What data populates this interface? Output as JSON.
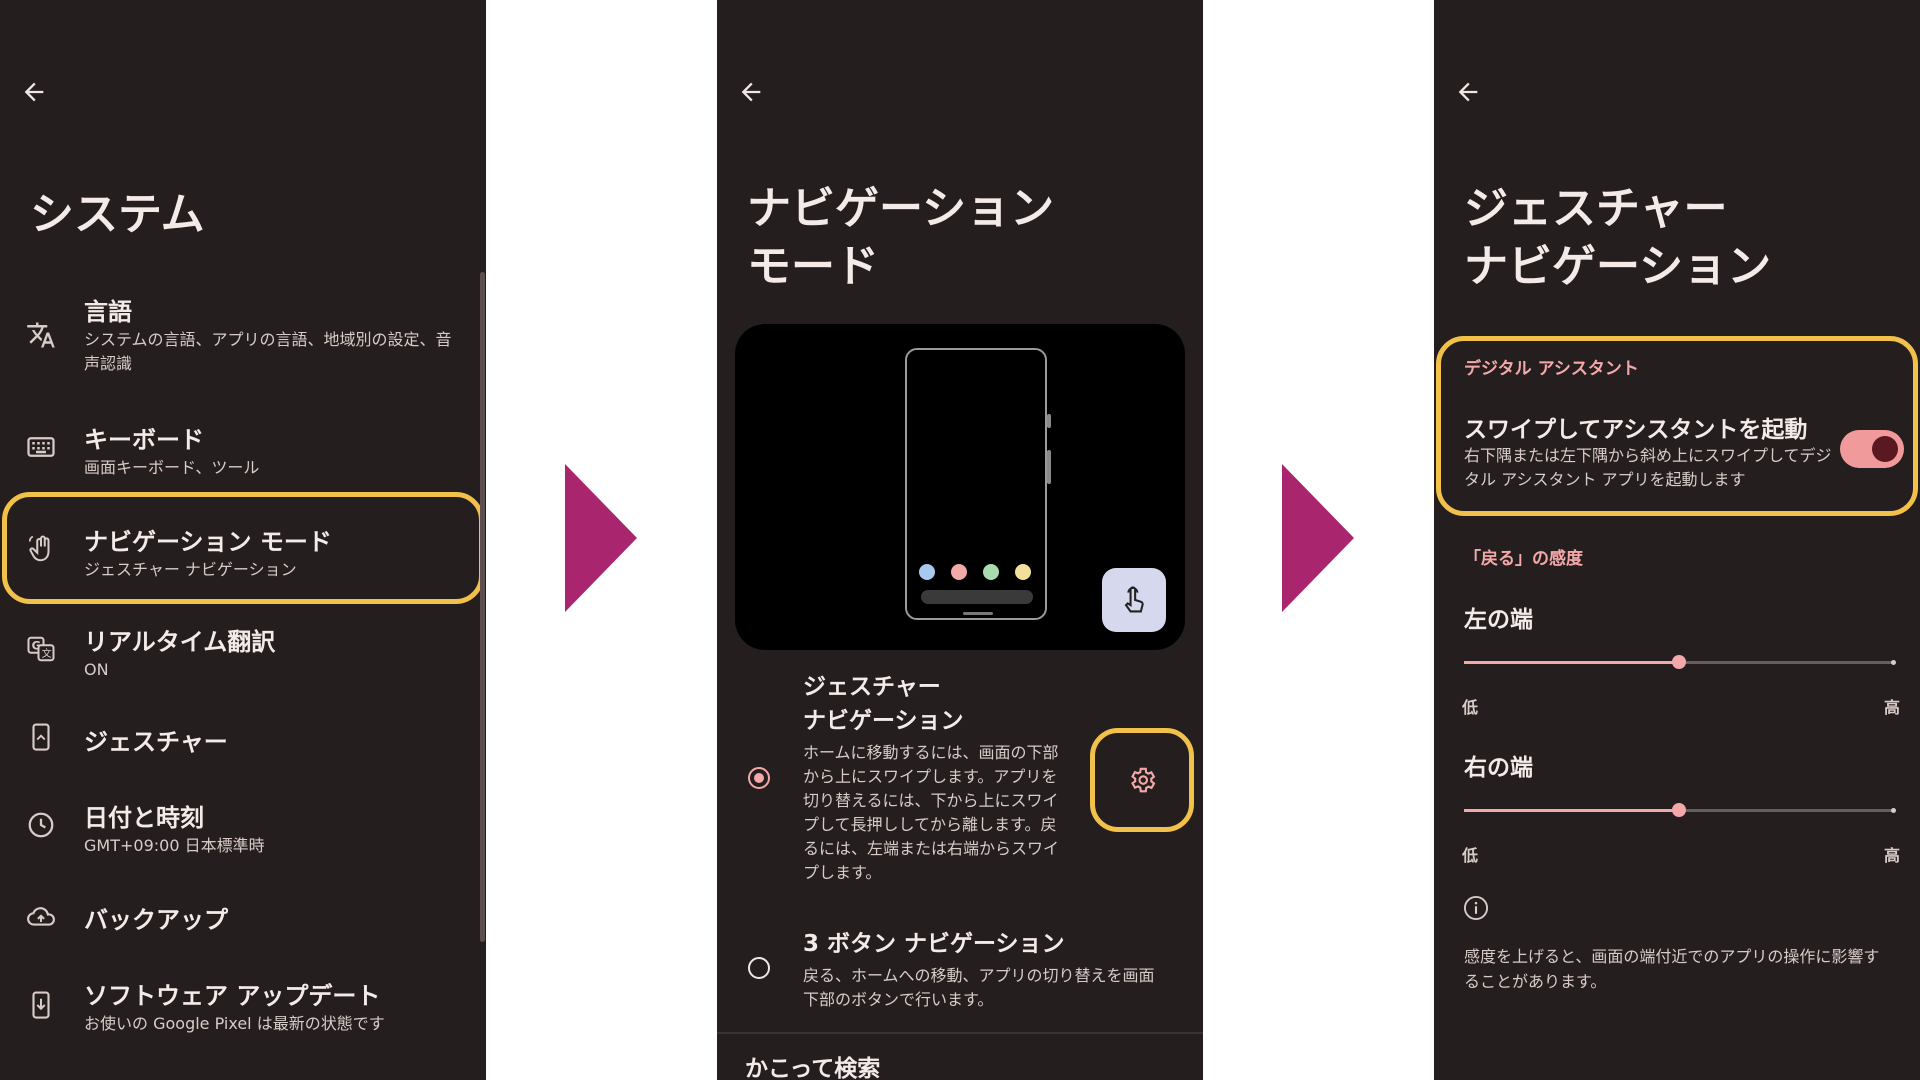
{
  "colors": {
    "panel_bg": "#251e1e",
    "highlight": "#f2c14a",
    "arrow": "#a9266e",
    "accent": "#f3a9a9"
  },
  "panel1": {
    "title": "システム",
    "items": [
      {
        "icon": "translate-icon",
        "title": "言語",
        "subtitle": "システムの言語、アプリの言語、地域別の設定、音声認識"
      },
      {
        "icon": "keyboard-icon",
        "title": "キーボード",
        "subtitle": "画面キーボード、ツール"
      },
      {
        "icon": "gesture-hand-icon",
        "title": "ナビゲーション モード",
        "subtitle": "ジェスチャー ナビゲーション"
      },
      {
        "icon": "live-translate-icon",
        "title": "リアルタイム翻訳",
        "subtitle": "ON"
      },
      {
        "icon": "phone-gesture-icon",
        "title": "ジェスチャー",
        "subtitle": ""
      },
      {
        "icon": "clock-icon",
        "title": "日付と時刻",
        "subtitle": "GMT+09:00 日本標準時"
      },
      {
        "icon": "cloud-backup-icon",
        "title": "バックアップ",
        "subtitle": ""
      },
      {
        "icon": "system-update-icon",
        "title": "ソフトウェア アップデート",
        "subtitle": "お使いの Google Pixel は最新の状態です"
      }
    ]
  },
  "panel2": {
    "title_line1": "ナビゲーション",
    "title_line2": "モード",
    "options": [
      {
        "title_line1": "ジェスチャー",
        "title_line2": "ナビゲーション",
        "description": "ホームに移動するには、画面の下部から上にスワイプします。アプリを切り替えるには、下から上にスワイプして長押ししてから離します。戻るには、左端または右端からスワイプします。",
        "selected": true
      },
      {
        "title_line1": "3 ボタン ナビゲーション",
        "description": "戻る、ホームへの移動、アプリの切り替えを画面下部のボタンで行います。",
        "selected": false
      }
    ],
    "next_section": "かこって検索",
    "preview_dot_colors": [
      "#a8c8f0",
      "#f2a9a9",
      "#a8dcb0",
      "#f3df9c"
    ]
  },
  "panel3": {
    "title_line1": "ジェスチャー",
    "title_line2": "ナビゲーション",
    "assistant_section": "デジタル アシスタント",
    "assistant_title": "スワイプしてアシスタントを起動",
    "assistant_sub": "右下隅または左下隅から斜め上にスワイプしてデジタル アシスタント アプリを起動します",
    "assistant_toggle_on": true,
    "back_section": "「戻る」の感度",
    "left_edge": {
      "label": "左の端",
      "value": 0.5,
      "low": "低",
      "high": "高"
    },
    "right_edge": {
      "label": "右の端",
      "value": 0.5,
      "low": "低",
      "high": "高"
    },
    "note": "感度を上げると、画面の端付近でのアプリの操作に影響することがあります。"
  }
}
